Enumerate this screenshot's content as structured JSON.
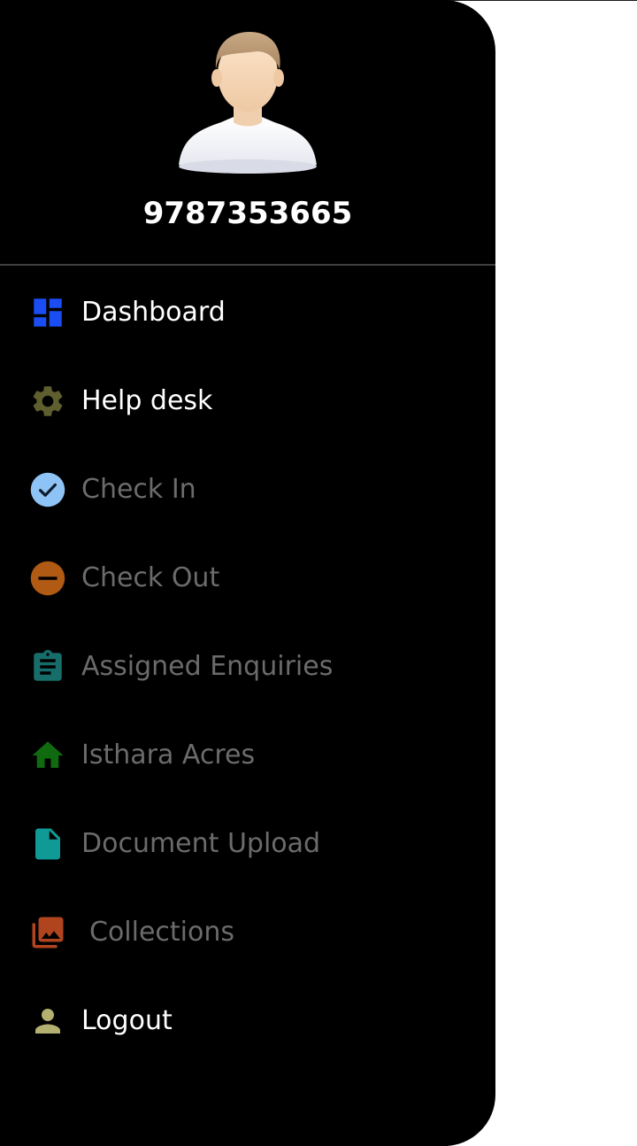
{
  "profile": {
    "phone": "9787353665"
  },
  "colors": {
    "drawer_bg": "#000000",
    "active_text": "#ffffff",
    "muted_text": "#6b6b6b"
  },
  "menu": {
    "items": [
      {
        "label": "Dashboard",
        "icon": "dashboard-icon",
        "icon_color": "#1a4df2",
        "enabled": true
      },
      {
        "label": "Help desk",
        "icon": "gear-icon",
        "icon_color": "#5e5e2e",
        "enabled": true
      },
      {
        "label": "Check In",
        "icon": "check-circle-icon",
        "icon_color": "#8ec3f5",
        "enabled": false
      },
      {
        "label": "Check Out",
        "icon": "minus-circle-icon",
        "icon_color": "#b05a14",
        "enabled": false
      },
      {
        "label": "Assigned Enquiries",
        "icon": "clipboard-icon",
        "icon_color": "#176d6a",
        "enabled": false
      },
      {
        "label": "Isthara Acres",
        "icon": "home-icon",
        "icon_color": "#106b10",
        "enabled": false
      },
      {
        "label": "Document Upload",
        "icon": "document-icon",
        "icon_color": "#0f9a95",
        "enabled": false
      },
      {
        "label": "Collections",
        "icon": "photo-library-icon",
        "icon_color": "#b0441e",
        "enabled": false
      },
      {
        "label": "Logout",
        "icon": "person-icon",
        "icon_color": "#b3b070",
        "enabled": true
      }
    ]
  }
}
